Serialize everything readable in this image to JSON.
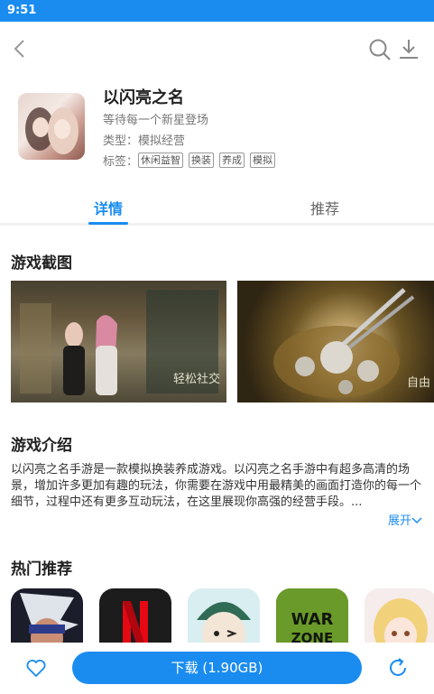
{
  "status": {
    "time": "9:51"
  },
  "app": {
    "title": "以闪亮之名",
    "subtitle": "等待每一个新星登场",
    "type_label": "类型：模拟经营",
    "tags_label": "标签：",
    "tags": [
      "休闲益智",
      "换装",
      "养成",
      "模拟"
    ]
  },
  "tabs": [
    {
      "label": "详情",
      "active": true
    },
    {
      "label": "推荐",
      "active": false
    }
  ],
  "screenshots": {
    "title": "游戏截图",
    "shot1_caption": "轻松社交",
    "shot2_caption": "自由"
  },
  "intro": {
    "title": "游戏介绍",
    "text": "以闪亮之名手游是一款模拟换装养成游戏。以闪亮之名手游中有超多高清的场景，增加许多更加有趣的玩法，你需要在游戏中用最精美的画面打造你的每一个细节，过程中还有更多互动玩法，在这里展现你高强的经营手段。...",
    "expand_label": "展开"
  },
  "hot": {
    "title": "热门推荐"
  },
  "bottom": {
    "download_label": "下载 (1.90GB)"
  },
  "colors": {
    "accent": "#1a8cf0"
  },
  "icons": [
    "back-icon",
    "search-icon",
    "download-icon",
    "heart-icon",
    "refresh-icon",
    "chevron-down-icon"
  ]
}
